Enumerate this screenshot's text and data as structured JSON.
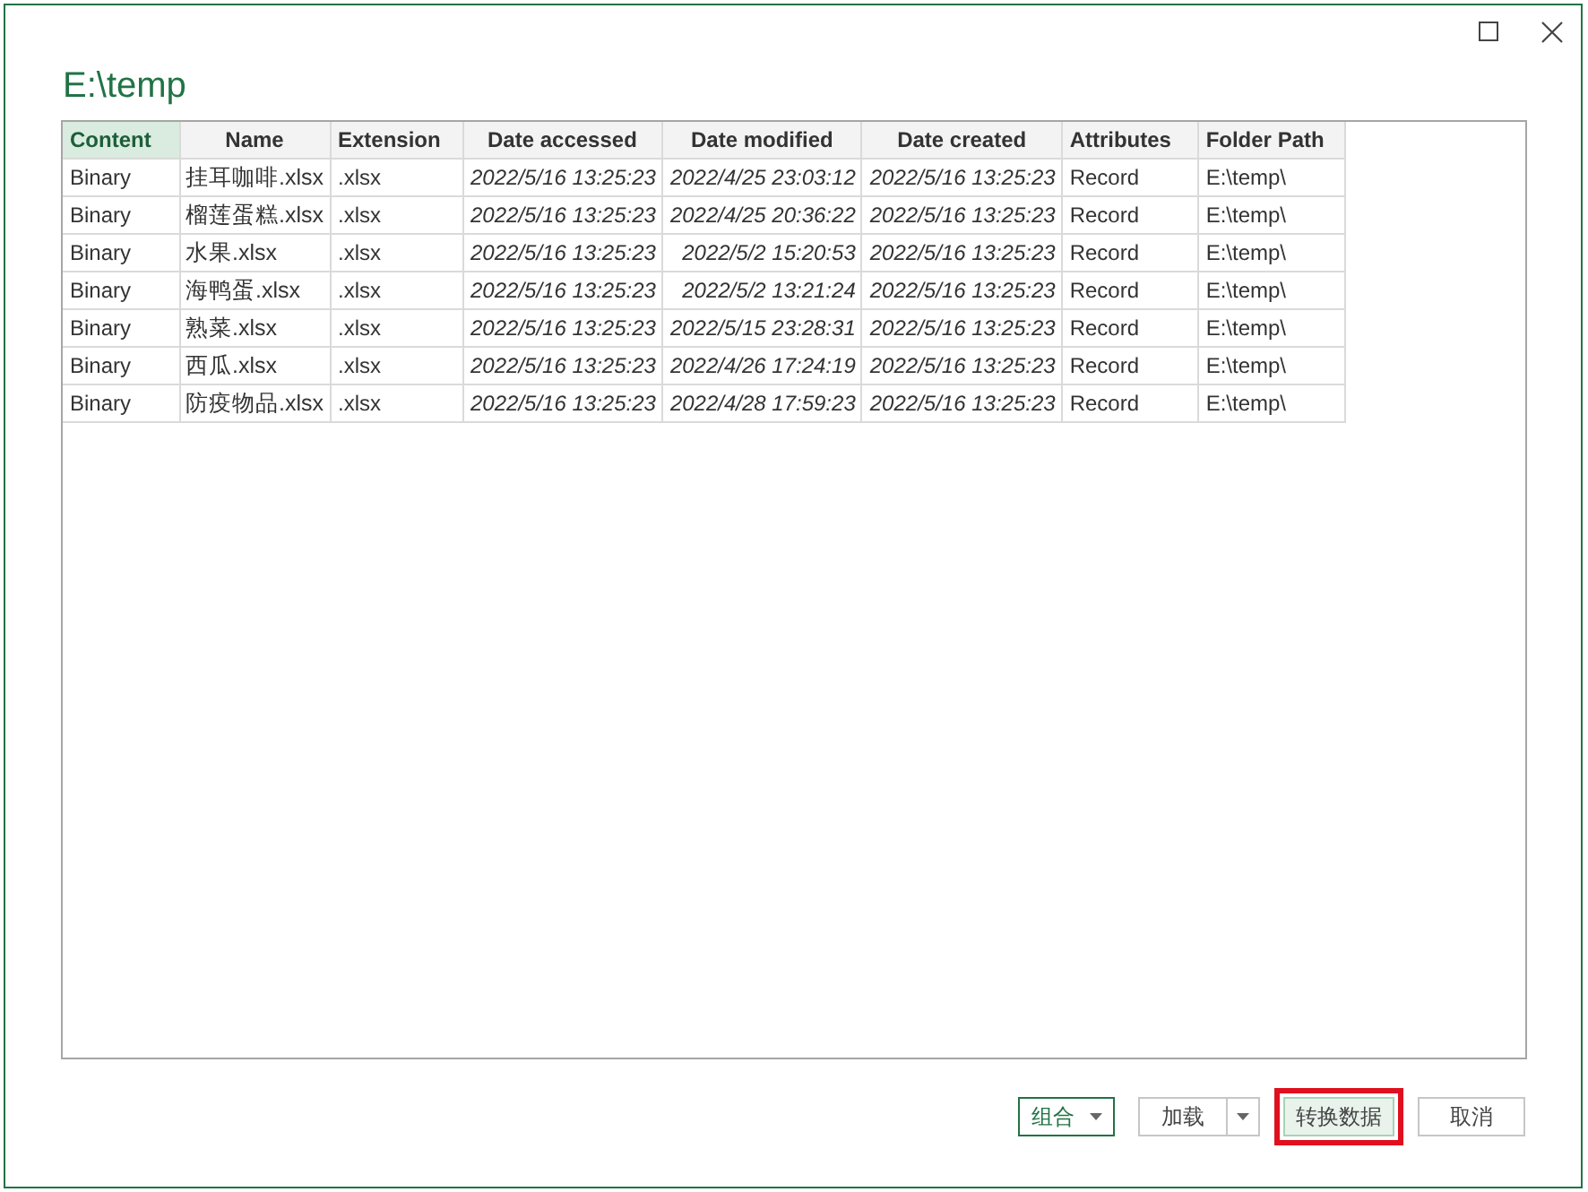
{
  "window": {
    "title": "E:\\temp"
  },
  "table": {
    "columns": [
      {
        "label": "Content",
        "selected": true
      },
      {
        "label": "Name",
        "selected": false
      },
      {
        "label": "Extension",
        "selected": false
      },
      {
        "label": "Date accessed",
        "selected": false
      },
      {
        "label": "Date modified",
        "selected": false
      },
      {
        "label": "Date created",
        "selected": false
      },
      {
        "label": "Attributes",
        "selected": false
      },
      {
        "label": "Folder Path",
        "selected": false
      }
    ],
    "rows": [
      [
        "Binary",
        "挂耳咖啡.xlsx",
        ".xlsx",
        "2022/5/16 13:25:23",
        "2022/4/25 23:03:12",
        "2022/5/16 13:25:23",
        "Record",
        "E:\\temp\\"
      ],
      [
        "Binary",
        "榴莲蛋糕.xlsx",
        ".xlsx",
        "2022/5/16 13:25:23",
        "2022/4/25 20:36:22",
        "2022/5/16 13:25:23",
        "Record",
        "E:\\temp\\"
      ],
      [
        "Binary",
        "水果.xlsx",
        ".xlsx",
        "2022/5/16 13:25:23",
        "2022/5/2 15:20:53",
        "2022/5/16 13:25:23",
        "Record",
        "E:\\temp\\"
      ],
      [
        "Binary",
        "海鸭蛋.xlsx",
        ".xlsx",
        "2022/5/16 13:25:23",
        "2022/5/2 13:21:24",
        "2022/5/16 13:25:23",
        "Record",
        "E:\\temp\\"
      ],
      [
        "Binary",
        "熟菜.xlsx",
        ".xlsx",
        "2022/5/16 13:25:23",
        "2022/5/15 23:28:31",
        "2022/5/16 13:25:23",
        "Record",
        "E:\\temp\\"
      ],
      [
        "Binary",
        "西瓜.xlsx",
        ".xlsx",
        "2022/5/16 13:25:23",
        "2022/4/26 17:24:19",
        "2022/5/16 13:25:23",
        "Record",
        "E:\\temp\\"
      ],
      [
        "Binary",
        "防疫物品.xlsx",
        ".xlsx",
        "2022/5/16 13:25:23",
        "2022/4/28 17:59:23",
        "2022/5/16 13:25:23",
        "Record",
        "E:\\temp\\"
      ]
    ]
  },
  "buttons": [
    {
      "label": "组合",
      "kind": "dropdown",
      "highlighted": false
    },
    {
      "label": "加载",
      "kind": "split",
      "highlighted": false
    },
    {
      "label": "转换数据",
      "kind": "primary",
      "highlighted": true
    },
    {
      "label": "取消",
      "kind": "plain",
      "highlighted": false
    }
  ]
}
